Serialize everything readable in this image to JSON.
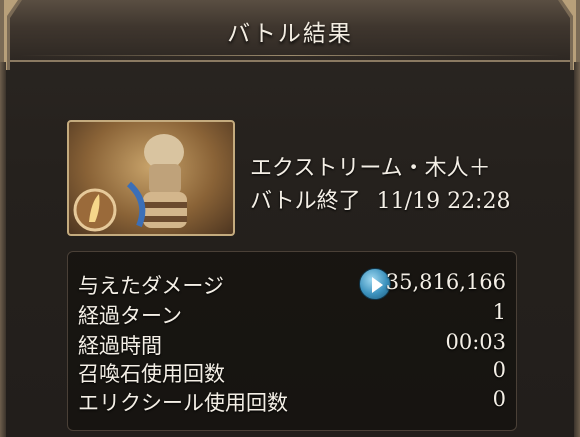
{
  "header": {
    "title": "バトル結果"
  },
  "quest": {
    "name": "エクストリーム・木人＋",
    "status_label": "バトル終了",
    "timestamp": "11/19 22:28"
  },
  "stats": [
    {
      "label": "与えたダメージ",
      "value": "35,816,166"
    },
    {
      "label": "経過ターン",
      "value": "1"
    },
    {
      "label": "経過時間",
      "value": "00:03"
    },
    {
      "label": "召喚石使用回数",
      "value": "0"
    },
    {
      "label": "エリクシール使用回数",
      "value": "0"
    }
  ],
  "colors": {
    "text": "#f4efe6",
    "frame_gold": "#c4ab7e",
    "play_button": "#3c92be"
  },
  "icons": {
    "damage_detail": "play-icon",
    "quest_element": "wind-element-icon"
  }
}
